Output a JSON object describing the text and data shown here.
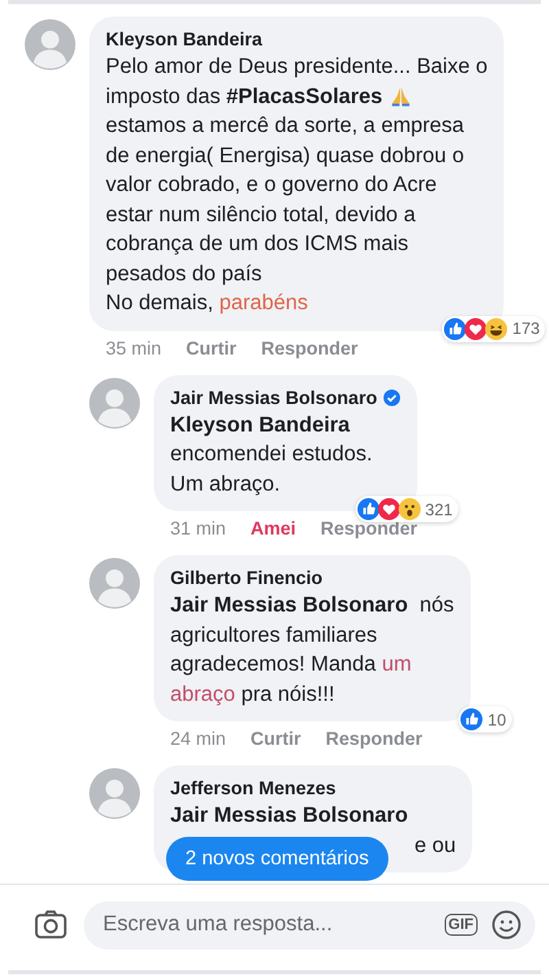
{
  "comments": [
    {
      "author": "Kleyson Bandeira",
      "lines": [
        [
          {
            "kind": "plain",
            "text": "Pelo amor de Deus presidente... Baixe o"
          }
        ],
        [
          {
            "kind": "plain",
            "text": "imposto das "
          },
          {
            "kind": "hashtag",
            "text": "#PlacasSolares"
          },
          {
            "kind": "pray-emoji"
          }
        ],
        [
          {
            "kind": "plain",
            "text": "estamos a mercê da sorte, a empresa"
          }
        ],
        [
          {
            "kind": "plain",
            "text": "de energia( Energisa) quase dobrou o"
          }
        ],
        [
          {
            "kind": "plain",
            "text": "valor cobrado, e o governo do Acre"
          }
        ],
        [
          {
            "kind": "plain",
            "text": "estar num silêncio total, devido a"
          }
        ],
        [
          {
            "kind": "plain",
            "text": "cobrança de um dos ICMS mais"
          }
        ],
        [
          {
            "kind": "plain",
            "text": "pesados do país"
          }
        ],
        [
          {
            "kind": "plain",
            "text": "No demais, "
          },
          {
            "kind": "highlight",
            "text": "parabéns"
          }
        ]
      ],
      "time": "35 min",
      "like_label": "Curtir",
      "loved": false,
      "reply_label": "Responder",
      "reactions": [
        {
          "kind": "like"
        },
        {
          "kind": "love"
        },
        {
          "kind": "haha"
        }
      ],
      "reaction_count": "173",
      "children": [
        {
          "author": "Jair Messias Bolsonaro",
          "verified": true,
          "lines": [
            [
              {
                "kind": "mention",
                "text": "Kleyson Bandeira"
              }
            ],
            [
              {
                "kind": "plain",
                "text": "encomendei estudos."
              }
            ],
            [
              {
                "kind": "plain",
                "text": "Um abraço."
              }
            ]
          ],
          "time": "31 min",
          "like_label": "Amei",
          "loved": true,
          "reply_label": "Responder",
          "reactions": [
            {
              "kind": "like"
            },
            {
              "kind": "love"
            },
            {
              "kind": "wow"
            }
          ],
          "reaction_count": "321"
        },
        {
          "author": "Gilberto Finencio",
          "lines": [
            [
              {
                "kind": "mention",
                "text": "Jair Messias Bolsonaro"
              },
              {
                "kind": "plain",
                "text": "  nós"
              }
            ],
            [
              {
                "kind": "plain",
                "text": "agricultores familiares"
              }
            ],
            [
              {
                "kind": "plain",
                "text": "agradecemos! Manda "
              },
              {
                "kind": "highlight",
                "text": "um"
              }
            ],
            [
              {
                "kind": "highlight",
                "text": "abraço"
              },
              {
                "kind": "plain",
                "text": " pra nóis!!!"
              }
            ]
          ],
          "time": "24 min",
          "like_label": "Curtir",
          "loved": false,
          "reply_label": "Responder",
          "reactions": [
            {
              "kind": "like"
            }
          ],
          "reaction_count": "10"
        },
        {
          "author": "Jefferson Menezes",
          "lines": [
            [
              {
                "kind": "mention",
                "text": "Jair Messias Bolsonaro"
              }
            ],
            [
              {
                "kind": "plain",
                "text": "e ou",
                "covered_start": true
              }
            ]
          ]
        }
      ]
    }
  ],
  "new_comments_pill": "2 novos comentários",
  "reply_bar": {
    "placeholder": "Escreva uma resposta...",
    "gif_label": "GIF"
  }
}
